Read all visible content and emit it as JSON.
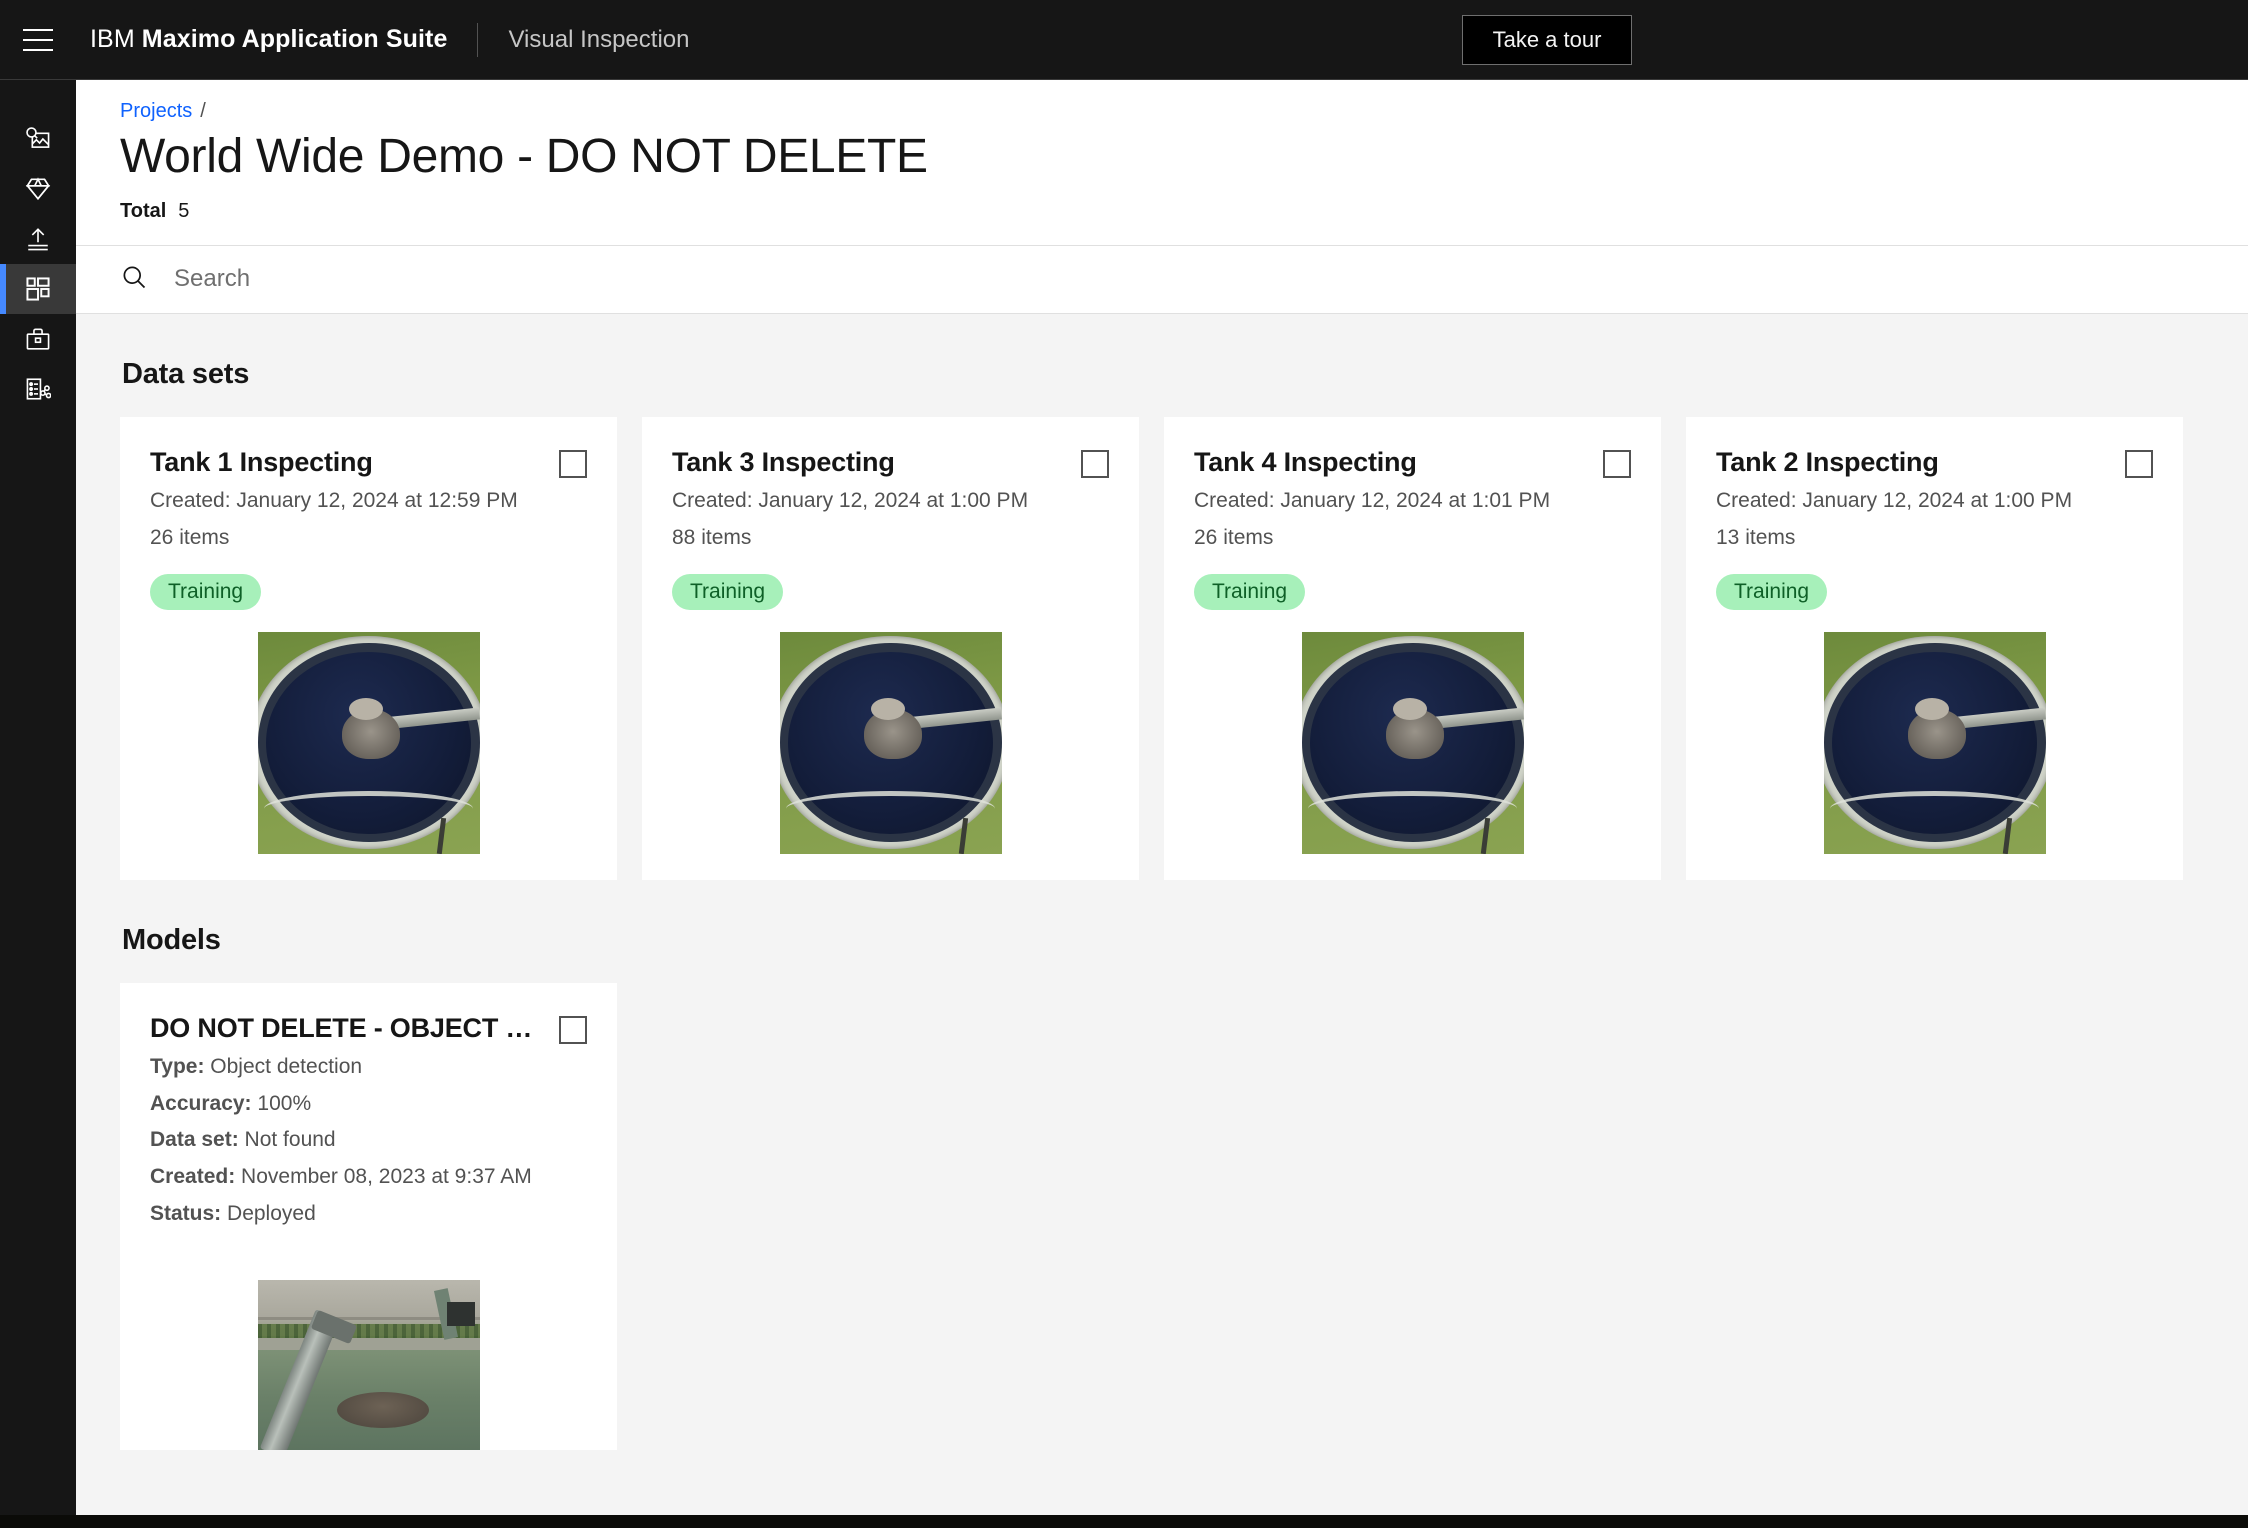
{
  "header": {
    "menu_icon": "hamburger-menu-icon",
    "brand_prefix": "IBM",
    "brand_name": "Maximo Application Suite",
    "product": "Visual Inspection",
    "tour_button": "Take a tour"
  },
  "sidebar": {
    "items": [
      {
        "icon": "image-search-icon",
        "active": false
      },
      {
        "icon": "diamond-icon",
        "active": false
      },
      {
        "icon": "upload-icon",
        "active": false
      },
      {
        "icon": "dashboard-grid-icon",
        "active": true
      },
      {
        "icon": "toolbox-icon",
        "active": false
      },
      {
        "icon": "deploy-list-icon",
        "active": false
      }
    ],
    "active_indicator_color": "#4589ff"
  },
  "page": {
    "breadcrumb": {
      "parent": "Projects",
      "separator": "/"
    },
    "title": "World Wide Demo - DO NOT DELETE",
    "total_label": "Total",
    "total_value": "5"
  },
  "search": {
    "placeholder": "Search",
    "value": "",
    "icon": "search-icon"
  },
  "data_sets": {
    "section_title": "Data sets",
    "cards": [
      {
        "title": "Tank 1 Inspecting",
        "created": "Created: January 12, 2024 at 12:59 PM",
        "items": "26 items",
        "tag": "Training",
        "thumbnail": "aerial-circular-water-tank"
      },
      {
        "title": "Tank 3 Inspecting",
        "created": "Created: January 12, 2024 at 1:00 PM",
        "items": "88 items",
        "tag": "Training",
        "thumbnail": "aerial-circular-water-tank"
      },
      {
        "title": "Tank 4 Inspecting",
        "created": "Created: January 12, 2024 at 1:01 PM",
        "items": "26 items",
        "tag": "Training",
        "thumbnail": "aerial-circular-water-tank"
      },
      {
        "title": "Tank 2 Inspecting",
        "created": "Created: January 12, 2024 at 1:00 PM",
        "items": "13 items",
        "tag": "Training",
        "thumbnail": "aerial-circular-water-tank"
      }
    ]
  },
  "models": {
    "section_title": "Models",
    "cards": [
      {
        "title": "DO NOT DELETE - OBJECT DET...",
        "type_label": "Type:",
        "type_value": "Object detection",
        "accuracy_label": "Accuracy:",
        "accuracy_value": "100%",
        "dataset_label": "Data set:",
        "dataset_value": "Not found",
        "created_label": "Created:",
        "created_value": "November 08, 2023 at 9:37 AM",
        "status_label": "Status:",
        "status_value": "Deployed",
        "thumbnail": "skimmer-arm-over-water"
      }
    ]
  },
  "colors": {
    "header_bg": "#161616",
    "page_bg": "#f4f4f4",
    "card_bg": "#ffffff",
    "accent_blue": "#0f62fe",
    "tag_bg": "#a7f0ba",
    "tag_text": "#0e6027"
  }
}
